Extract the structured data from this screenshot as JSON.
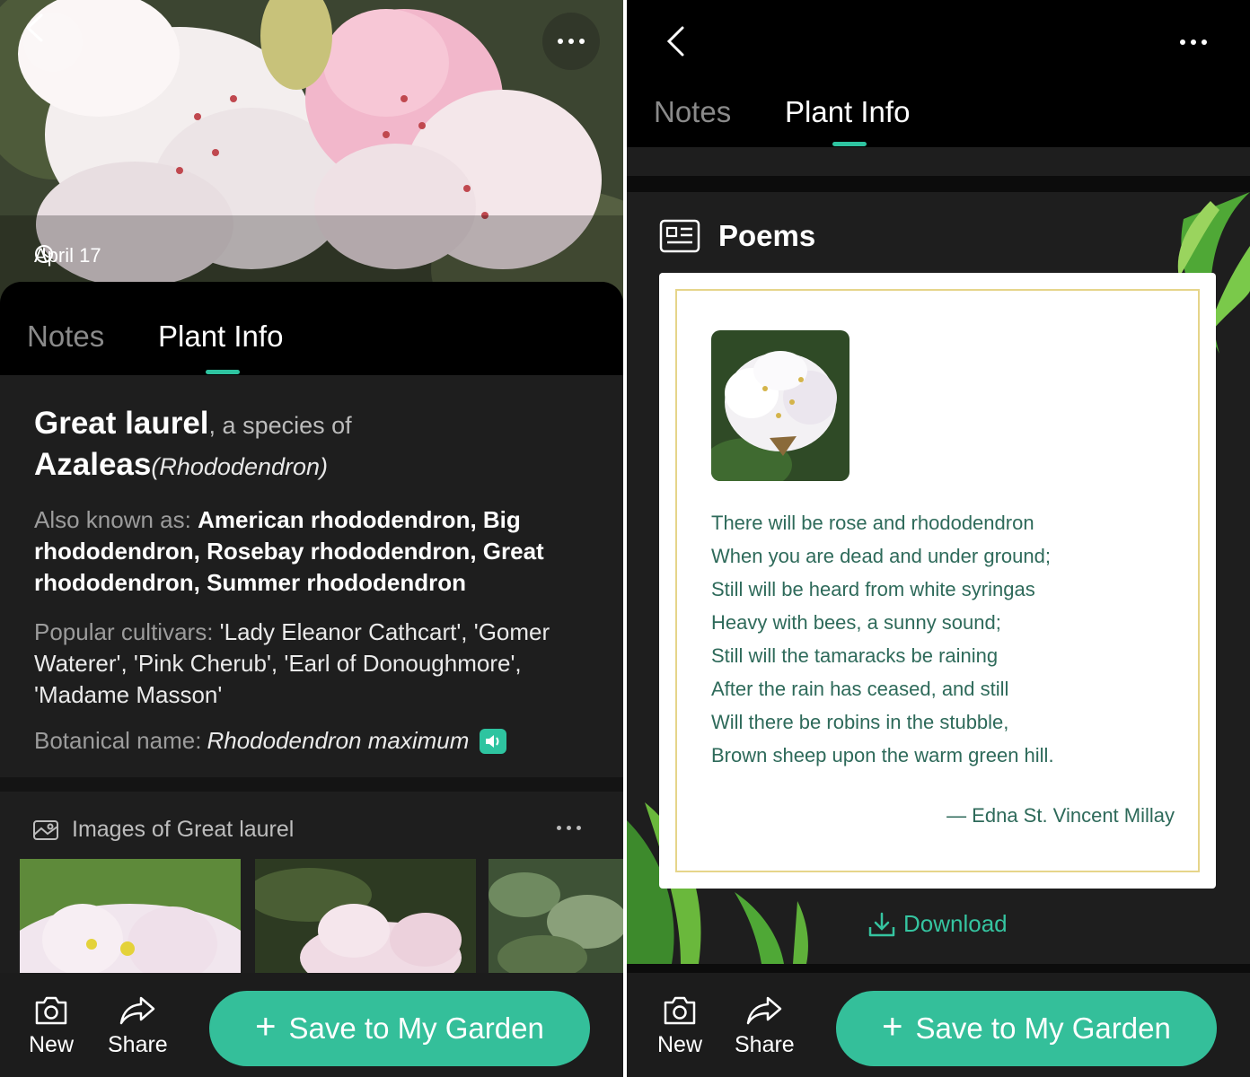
{
  "left": {
    "hero": {
      "date": "April 17"
    },
    "tabs": [
      {
        "label": "Notes"
      },
      {
        "label": "Plant Info"
      }
    ],
    "info": {
      "common_name": "Great laurel",
      "species_connector": ", a species of",
      "genus": "Azaleas",
      "genus_latin": "(Rhododendron)",
      "aka_label": "Also known as: ",
      "aka_value": "American rhododendron, Big rhododendron, Rosebay rhododendron, Great rhododendron, Summer rhododendron",
      "cultivars_label": "Popular cultivars: ",
      "cultivars_value": "'Lady Eleanor Cathcart', 'Gomer Waterer', 'Pink Cherub', 'Earl of Donoughmore', 'Madame Masson'",
      "botanical_label": "Botanical name:",
      "botanical_value": "Rhododendron maximum"
    },
    "images_section": {
      "title": "Images of Great laurel"
    },
    "bottom": {
      "new_label": "New",
      "share_label": "Share",
      "save_plus": "+",
      "save_label": "Save to My Garden"
    }
  },
  "right": {
    "tabs": [
      {
        "label": "Notes"
      },
      {
        "label": "Plant Info"
      }
    ],
    "poems": {
      "title": "Poems",
      "lines": [
        "There will be rose and rhododendron",
        "When you are dead and under ground;",
        "Still will be heard from white syringas",
        "Heavy with bees, a sunny sound;",
        "Still will the tamaracks be raining",
        "After the rain has ceased, and still",
        "Will there be robins in the stubble,",
        "Brown sheep upon the warm green hill."
      ],
      "author": "— Edna St. Vincent Millay",
      "download_label": "Download"
    },
    "bottom": {
      "new_label": "New",
      "share_label": "Share",
      "save_plus": "+",
      "save_label": "Save to My Garden"
    }
  },
  "colors": {
    "accent": "#34bf9a",
    "poem_text": "#2e6a5a",
    "card_border": "#e6d58a"
  },
  "icons": [
    "chevron-left-icon",
    "more-icon",
    "clock-icon",
    "speaker-icon",
    "gallery-icon",
    "camera-icon",
    "share-icon",
    "poem-card-icon",
    "download-icon"
  ]
}
